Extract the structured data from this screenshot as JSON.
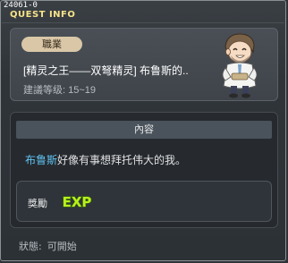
{
  "window": {
    "quest_id": "24061-0",
    "title": "QUEST INFO"
  },
  "header": {
    "job_label": "職業",
    "quest_name": "[精灵之王——双弩精灵] 布鲁斯的..",
    "level_text": "建議等级: 15~19",
    "npc_icon": "npc-portrait"
  },
  "content": {
    "section_title": "內容",
    "npc_name": "布鲁斯",
    "description_rest": "好像有事想拜托伟大的我。",
    "reward_label": "獎勵",
    "reward_icon": "exp-icon",
    "reward_icon_text": "EXP"
  },
  "status": {
    "label": "狀態:",
    "value": "可開始"
  },
  "colors": {
    "title": "#f7e38a",
    "link": "#5fc2f0",
    "exp": "#b7f01b"
  }
}
